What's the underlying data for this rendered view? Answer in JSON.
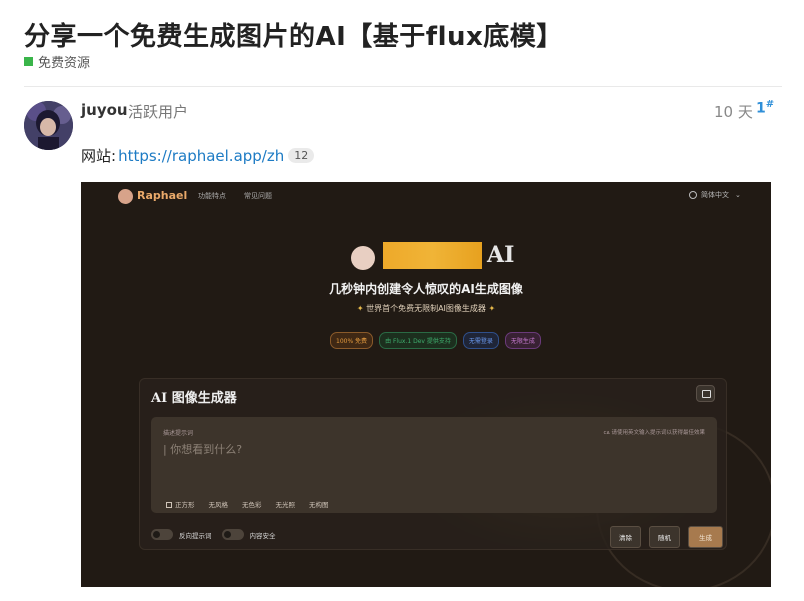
{
  "topic": {
    "title": "分享一个免费生成图片的AI【基于flux底模】",
    "category": "免费资源",
    "category_color": "#3ab54a"
  },
  "post": {
    "username": "juyou",
    "user_title": "活跃用户",
    "time_ago": "10 天",
    "post_number": "1",
    "post_number_suffix": "#",
    "site_label": "网站:",
    "site_url": "https://raphael.app/zh",
    "link_clicks": "12"
  },
  "embedded": {
    "brand": "Raphael",
    "nav_links": [
      "功能特点",
      "常见问题"
    ],
    "language": "简体中文",
    "hero_ai": "AI",
    "hero_subtitle": "几秒钟内创建令人惊叹的AI生成图像",
    "hero_tagline": "世界首个免费无限制AI图像生成器",
    "badges": [
      {
        "text": "100% 免费",
        "color": "#e29a3f"
      },
      {
        "text": "由 Flux.1 Dev 提供支持",
        "color": "#3fae6e"
      },
      {
        "text": "无需登录",
        "color": "#4b7fe0"
      },
      {
        "text": "无限生成",
        "color": "#c77ad1"
      }
    ],
    "card_title": "AI 图像生成器",
    "prompt_label": "描述提示词",
    "prompt_hint": "请使用英文输入提示词以获得最佳效果",
    "prompt_placeholder": "你想看到什么?",
    "options": [
      "正方形",
      "无风格",
      "无色彩",
      "无光照",
      "无构图"
    ],
    "toggles": [
      "反向提示词",
      "内容安全"
    ],
    "buttons": {
      "clear": "清除",
      "random": "随机",
      "generate": "生成"
    }
  }
}
